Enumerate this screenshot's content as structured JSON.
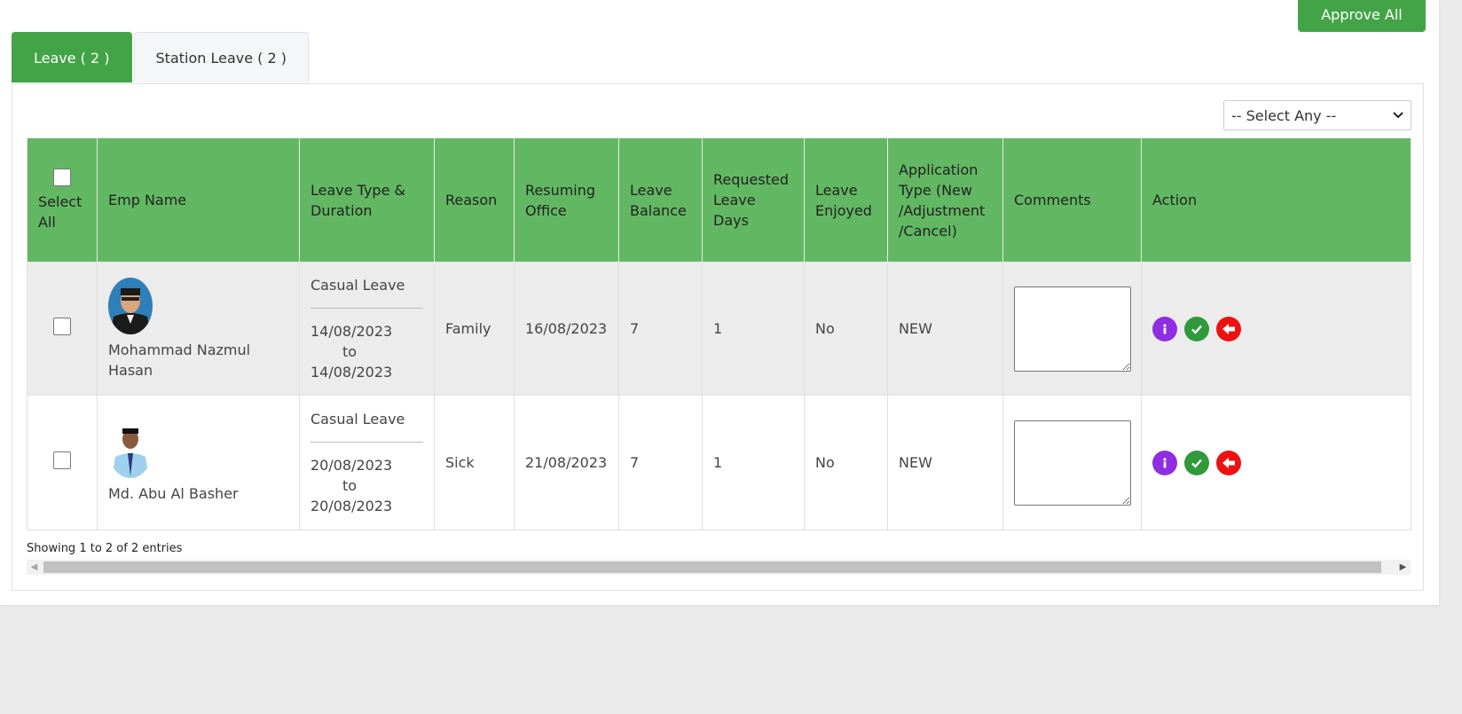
{
  "toolbar": {
    "approve_all_label": "Approve All"
  },
  "tabs": [
    {
      "label": "Leave ( 2 )",
      "active": true
    },
    {
      "label": "Station Leave ( 2 )",
      "active": false
    }
  ],
  "filter": {
    "selected": "-- Select Any --"
  },
  "table": {
    "headers": {
      "select_all": "Select All",
      "emp_name": "Emp Name",
      "leave_type": "Leave Type & Duration",
      "reason": "Reason",
      "resuming_office": "Resuming Office",
      "leave_balance": "Leave Balance",
      "requested_days": "Requested Leave Days",
      "leave_enjoyed": "Leave Enjoyed",
      "application_type": "Application Type (New /Adjustment /Cancel)",
      "comments": "Comments",
      "action": "Action"
    },
    "rows": [
      {
        "emp_name": "Mohammad Nazmul Hasan",
        "leave_type": "Casual Leave",
        "from": "14/08/2023",
        "to_word": "to",
        "to": "14/08/2023",
        "reason": "Family",
        "resuming_office": "16/08/2023",
        "leave_balance": "7",
        "requested_days": "1",
        "leave_enjoyed": "No",
        "application_type": "NEW",
        "comment": ""
      },
      {
        "emp_name": "Md. Abu Al Basher",
        "leave_type": "Casual Leave",
        "from": "20/08/2023",
        "to_word": "to",
        "to": "20/08/2023",
        "reason": "Sick",
        "resuming_office": "21/08/2023",
        "leave_balance": "7",
        "requested_days": "1",
        "leave_enjoyed": "No",
        "application_type": "NEW",
        "comment": ""
      }
    ]
  },
  "footer": {
    "entries_text": "Showing 1 to 2 of 2 entries"
  },
  "colors": {
    "primary_green": "#43a447",
    "header_green": "#62b862",
    "info_purple": "#8e2de2",
    "approve_green": "#2e9a3a",
    "return_red": "#ee1111"
  },
  "icons": {
    "info": "info-icon",
    "approve": "check-icon",
    "return": "arrow-left-icon",
    "select_chevron": "chevron-down-icon"
  }
}
